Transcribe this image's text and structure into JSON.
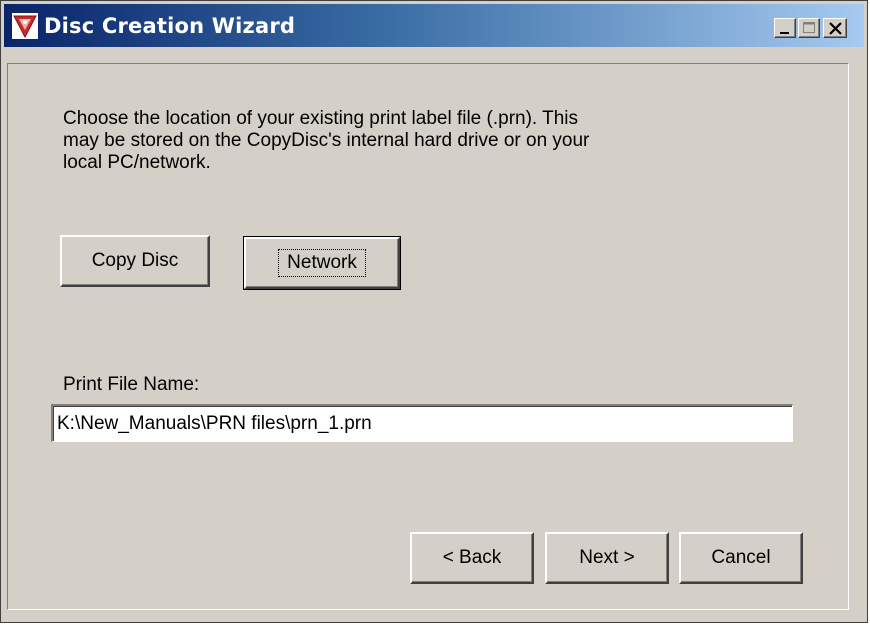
{
  "window": {
    "title": "Disc Creation Wizard",
    "app_icon": "disc-wizard-icon",
    "controls": [
      "minimize-icon",
      "maximize-icon",
      "close-icon"
    ]
  },
  "content": {
    "instructions": "Choose the location of your existing print label file (.prn). This\nmay be stored on the CopyDisc's internal hard drive or on your\nlocal PC/network.",
    "source_buttons": {
      "copy_disc": "Copy Disc",
      "network": "Network",
      "focused": "Network"
    },
    "print_file": {
      "label": "Print File Name:",
      "value": "K:\\New_Manuals\\PRN files\\prn_1.prn"
    }
  },
  "footer": {
    "back": "< Back",
    "next": "Next >",
    "cancel": "Cancel"
  },
  "colors": {
    "title_gradient_start": "#0a246a",
    "title_gradient_end": "#a6caf0",
    "face": "#d4d0c8",
    "app_icon_red": "#cc2a2a"
  }
}
